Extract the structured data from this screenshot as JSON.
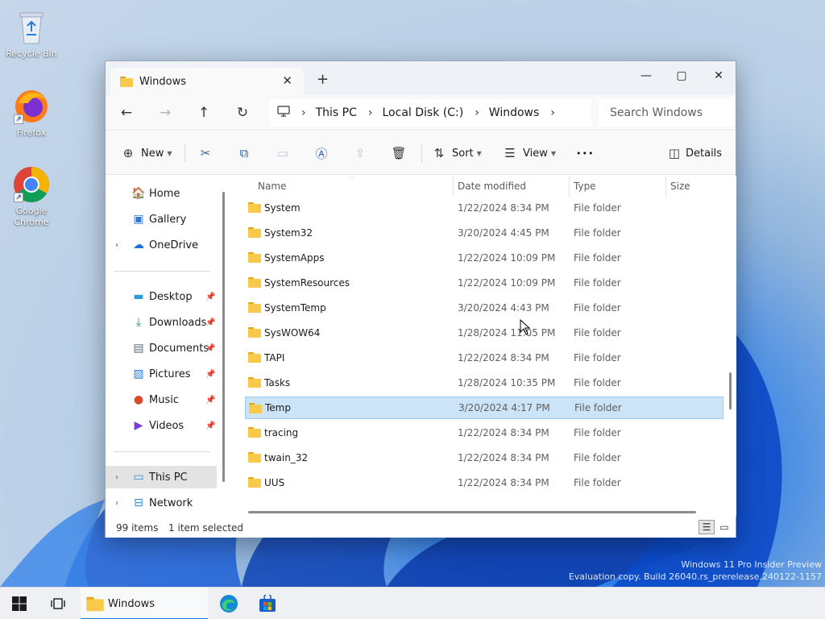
{
  "desktop": {
    "icons": [
      {
        "label": "Recycle Bin",
        "icon": "recycle-bin-icon"
      },
      {
        "label": "Firefox",
        "icon": "firefox-icon"
      },
      {
        "label": "Google Chrome",
        "icon": "chrome-icon"
      }
    ],
    "watermark": {
      "line1": "Windows 11 Pro Insider Preview",
      "line2": "Evaluation copy. Build 26040.rs_prerelease.240122-1157"
    }
  },
  "window": {
    "tab_title": "Windows",
    "tab_close": "✕",
    "new_tab": "+",
    "controls": {
      "minimize": "—",
      "maximize": "▢",
      "close": "✕"
    },
    "nav": {
      "back": "←",
      "forward": "→",
      "up": "↑",
      "refresh": "↻"
    },
    "breadcrumb": [
      "This PC",
      "Local Disk (C:)",
      "Windows"
    ],
    "breadcrumb_sep": "›",
    "search_placeholder": "Search Windows",
    "toolbar": {
      "new_label": "New",
      "sort_label": "Sort",
      "view_label": "View",
      "more_label": "•••",
      "details_label": "Details"
    },
    "sidebar": {
      "items": [
        {
          "label": "Home",
          "icon": "home-icon"
        },
        {
          "label": "Gallery",
          "icon": "gallery-icon"
        },
        {
          "label": "OneDrive",
          "icon": "cloud-icon"
        },
        {
          "label": "Desktop",
          "icon": "desktop-icon"
        },
        {
          "label": "Downloads",
          "icon": "download-icon"
        },
        {
          "label": "Documents",
          "icon": "documents-icon"
        },
        {
          "label": "Pictures",
          "icon": "pictures-icon"
        },
        {
          "label": "Music",
          "icon": "music-icon"
        },
        {
          "label": "Videos",
          "icon": "videos-icon"
        },
        {
          "label": "This PC",
          "icon": "computer-icon"
        },
        {
          "label": "Network",
          "icon": "network-icon"
        }
      ]
    },
    "columns": {
      "name": "Name",
      "date": "Date modified",
      "type": "Type",
      "size": "Size"
    },
    "files": [
      {
        "name": "System",
        "date": "1/22/2024 8:34 PM",
        "type": "File folder"
      },
      {
        "name": "System32",
        "date": "3/20/2024 4:45 PM",
        "type": "File folder"
      },
      {
        "name": "SystemApps",
        "date": "1/22/2024 10:09 PM",
        "type": "File folder"
      },
      {
        "name": "SystemResources",
        "date": "1/22/2024 10:09 PM",
        "type": "File folder"
      },
      {
        "name": "SystemTemp",
        "date": "3/20/2024 4:43 PM",
        "type": "File folder"
      },
      {
        "name": "SysWOW64",
        "date": "1/28/2024 11:05 PM",
        "type": "File folder"
      },
      {
        "name": "TAPI",
        "date": "1/22/2024 8:34 PM",
        "type": "File folder"
      },
      {
        "name": "Tasks",
        "date": "1/28/2024 10:35 PM",
        "type": "File folder"
      },
      {
        "name": "Temp",
        "date": "3/20/2024 4:17 PM",
        "type": "File folder"
      },
      {
        "name": "tracing",
        "date": "1/22/2024 8:34 PM",
        "type": "File folder"
      },
      {
        "name": "twain_32",
        "date": "1/22/2024 8:34 PM",
        "type": "File folder"
      },
      {
        "name": "UUS",
        "date": "1/22/2024 8:34 PM",
        "type": "File folder"
      }
    ],
    "status": {
      "count": "99 items",
      "selection": "1 item selected"
    }
  },
  "taskbar": {
    "explorer_label": "Windows"
  },
  "colors": {
    "selected_row": "#cce4f7",
    "accent": "#1a73d9",
    "folder": "#f8c94a"
  }
}
